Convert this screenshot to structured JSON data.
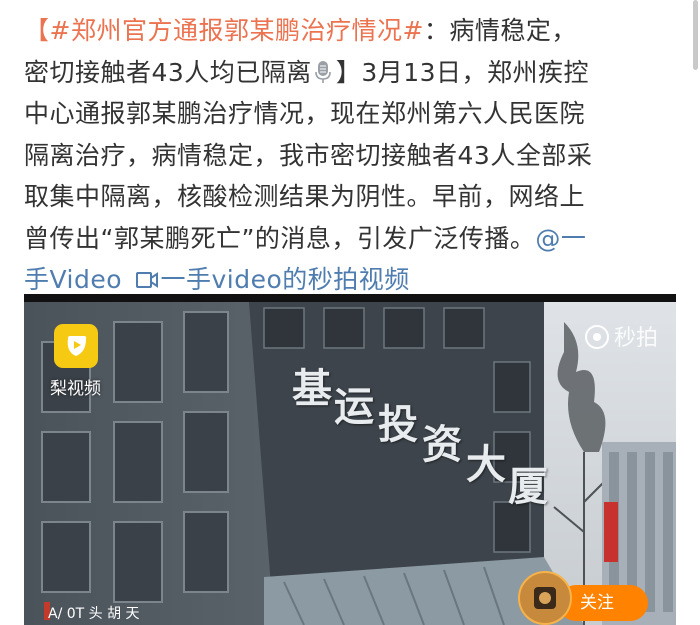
{
  "post": {
    "hashtag": "【#郑州官方通报郭某鹏治疗情况#",
    "line1_rest": "：病情稳定，",
    "line2_before": "密切接触者43人均已隔离",
    "line2_after": "】3月13日，郑州疾控",
    "line3": "中心通报郭某鹏治疗情况，现在郑州第六人民医院",
    "line4": "隔离治疗，病情稳定，我市密切接触者43人全部采",
    "line5": "取集中隔离，核酸检测结果为阴性。早前，网络上",
    "line6_text": "曾传出“郭某鹏死亡”的消息，引发广泛传播。",
    "mention_part1": "@一",
    "mention_part2": "手Video",
    "video_link_text": "一手video的秒拍视频"
  },
  "video": {
    "brand_name": "梨视频",
    "watermark": "秒拍",
    "building_sign": [
      "基",
      "运",
      "投",
      "资",
      "大",
      "厦"
    ],
    "follow_label": "关注",
    "bottom_caption": "A/ 0T 头 胡 天"
  },
  "colors": {
    "hashtag": "#eb7350",
    "link": "#507daf",
    "follow": "#ff8200"
  },
  "icons": {
    "mic": "microphone-icon",
    "video_link": "video-link-icon",
    "brand": "pear-video-logo-icon",
    "watermark": "miaopai-logo-icon"
  }
}
